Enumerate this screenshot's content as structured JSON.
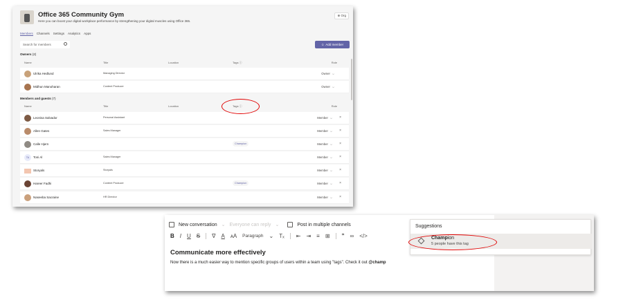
{
  "team": {
    "title": "Office 365 Community Gym",
    "more": "···",
    "description": "Here you can boost your digital workplace performance by strengthening your digital muscles using Office 365.",
    "org_label": "⊕ Org"
  },
  "tabs": [
    {
      "label": "Members",
      "active": true
    },
    {
      "label": "Channels"
    },
    {
      "label": "Settings"
    },
    {
      "label": "Analytics"
    },
    {
      "label": "Apps"
    }
  ],
  "search": {
    "placeholder": "Search for members"
  },
  "add_member_label": "Add member",
  "columns": {
    "name": "Name",
    "title": "Title",
    "location": "Location",
    "tags": "Tags ⓘ",
    "role": "Role"
  },
  "owners": {
    "label": "Owners",
    "count": "(2)",
    "rows": [
      {
        "name": "Ulrika Hedlund",
        "title": "Managing Director",
        "tag": "",
        "role": "Owner"
      },
      {
        "name": "Midhun Manoharan",
        "title": "Content Producer",
        "tag": "",
        "role": "Owner"
      }
    ]
  },
  "members": {
    "label": "Members and guests",
    "count": "(7)",
    "rows": [
      {
        "name": "Leonisa Salvador",
        "title": "Personal Assistant",
        "tag": "",
        "role": "Member"
      },
      {
        "name": "Allen Gates",
        "title": "Sales Manager",
        "tag": "",
        "role": "Member"
      },
      {
        "name": "Calle Hjern",
        "title": "",
        "tag": "Champion",
        "role": "Member"
      },
      {
        "name": "Toni Al",
        "initials": "TA",
        "title": "Sales Manager",
        "tag": "",
        "role": "Member"
      },
      {
        "name": "Storyals",
        "title": "Storyals",
        "tag": "",
        "role": "Member"
      },
      {
        "name": "Hareer Fadhi",
        "title": "Content Producer",
        "tag": "Champion",
        "role": "Member"
      },
      {
        "name": "Naseeba Sacraine",
        "title": "HR Director",
        "tag": "",
        "role": "Member"
      }
    ]
  },
  "compose": {
    "new_conversation": "New conversation",
    "everyone_can_reply": "Everyone can reply",
    "post_multiple": "Post in multiple channels",
    "paragraph": "Paragraph",
    "title": "Communicate more effectively",
    "body": "Now there is a much easier way to mention specific groups of users within a team using \"tags\". Check it out",
    "mention": "@champ"
  },
  "suggestions": {
    "header": "Suggestions",
    "item_bold": "Champ",
    "item_rest": "ion",
    "item_sub": "5 people have this tag"
  },
  "colors": {
    "accent": "#6264a7",
    "annotation": "#e00000"
  }
}
